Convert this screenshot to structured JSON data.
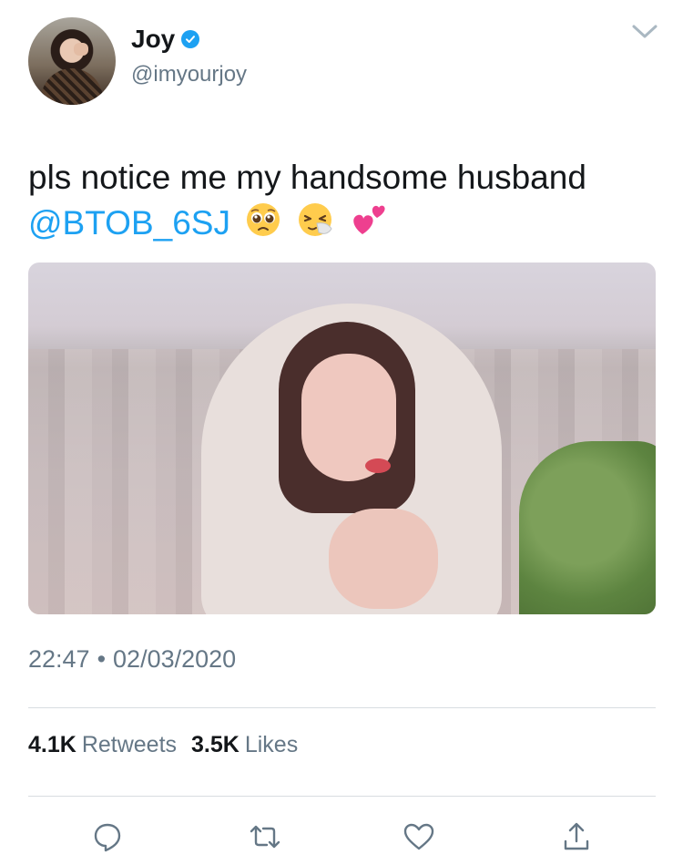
{
  "tweet": {
    "display_name": "Joy",
    "handle": "@imyourjoy",
    "text_plain": "pls notice me my handsome husband ",
    "mention": "@BTOB_6SJ",
    "emojis": [
      "🥺",
      "🤧",
      "💕"
    ],
    "time": "22:47",
    "separator": "•",
    "date": "02/03/2020",
    "retweets_count": "4.1K",
    "retweets_label": "Retweets",
    "likes_count": "3.5K",
    "likes_label": "Likes"
  },
  "icons": {
    "verified": "verified-badge-icon",
    "menu": "chevron-down-icon",
    "reply": "reply-icon",
    "retweet": "retweet-icon",
    "like": "heart-icon",
    "share": "share-icon"
  },
  "colors": {
    "accent": "#1da1f2",
    "text": "#14171a",
    "secondary": "#657786",
    "divider": "#d8dde1"
  }
}
